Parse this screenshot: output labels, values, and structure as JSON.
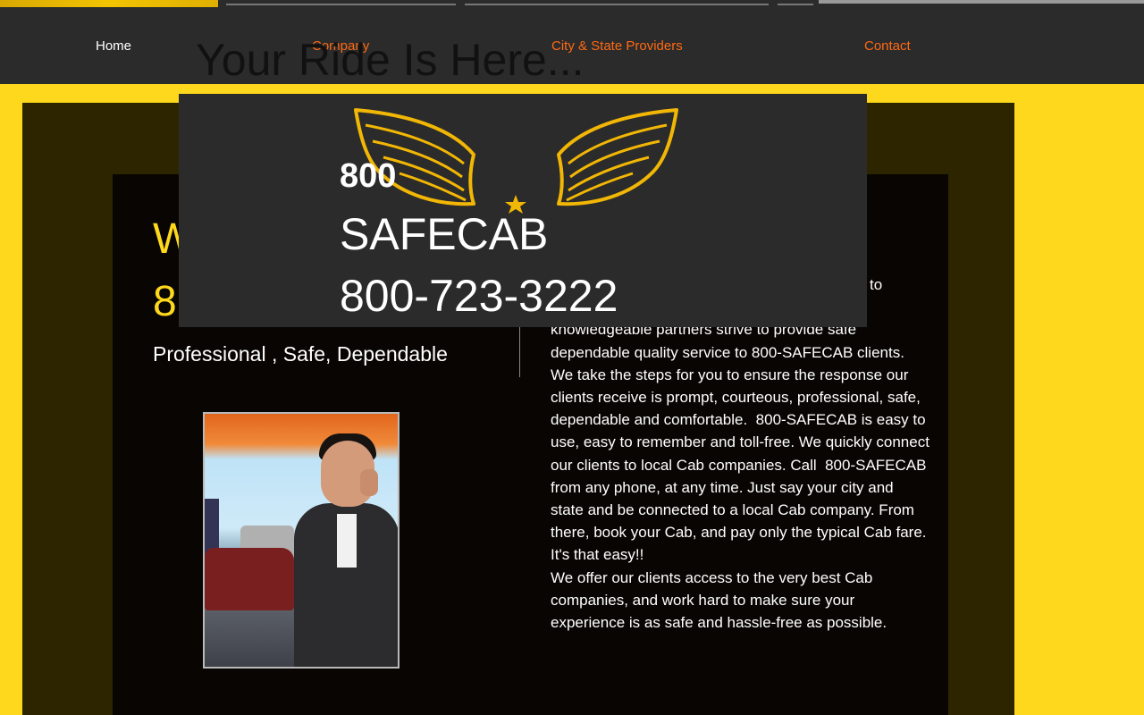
{
  "nav": {
    "home": "Home",
    "company": "Company",
    "city_state": "City & State Providers",
    "contact": "Contact"
  },
  "header": {
    "tagline": "Your Ride Is Here..."
  },
  "logo": {
    "line1": "800",
    "line2": "SAFECAB",
    "phone": "800-723-3222",
    "icon": "winged-star-logo"
  },
  "welcome": {
    "line1": "W",
    "line2": "8"
  },
  "slogan": "Professional , Safe, Dependable",
  "photo": {
    "description_icon": "businessman-on-phone-photo"
  },
  "about": {
    "paragraph1": "to our                       providers. Our professional & knowledgeable partners strive to provide safe dependable quality service to 800-SAFECAB clients.  We take the steps for you to ensure the response our clients receive is prompt, courteous, professional, safe, dependable and comfortable.  800-SAFECAB is easy to use, easy to remember and toll-free. We quickly connect our clients to local Cab companies. Call  800-SAFECAB from any phone, at any time. Just say your city and state and be connected to a local Cab company. From there, book your Cab, and pay only the typical Cab fare. It's that easy!!",
    "paragraph2": "We offer our clients access to the very best Cab companies, and work hard to make sure your experience is as safe and hassle-free as possible."
  },
  "colors": {
    "brand_yellow": "#fdd81c",
    "nav_bg": "#2b2b2b",
    "nav_link": "#ff6a13",
    "wing_gold": "#f2b705"
  }
}
